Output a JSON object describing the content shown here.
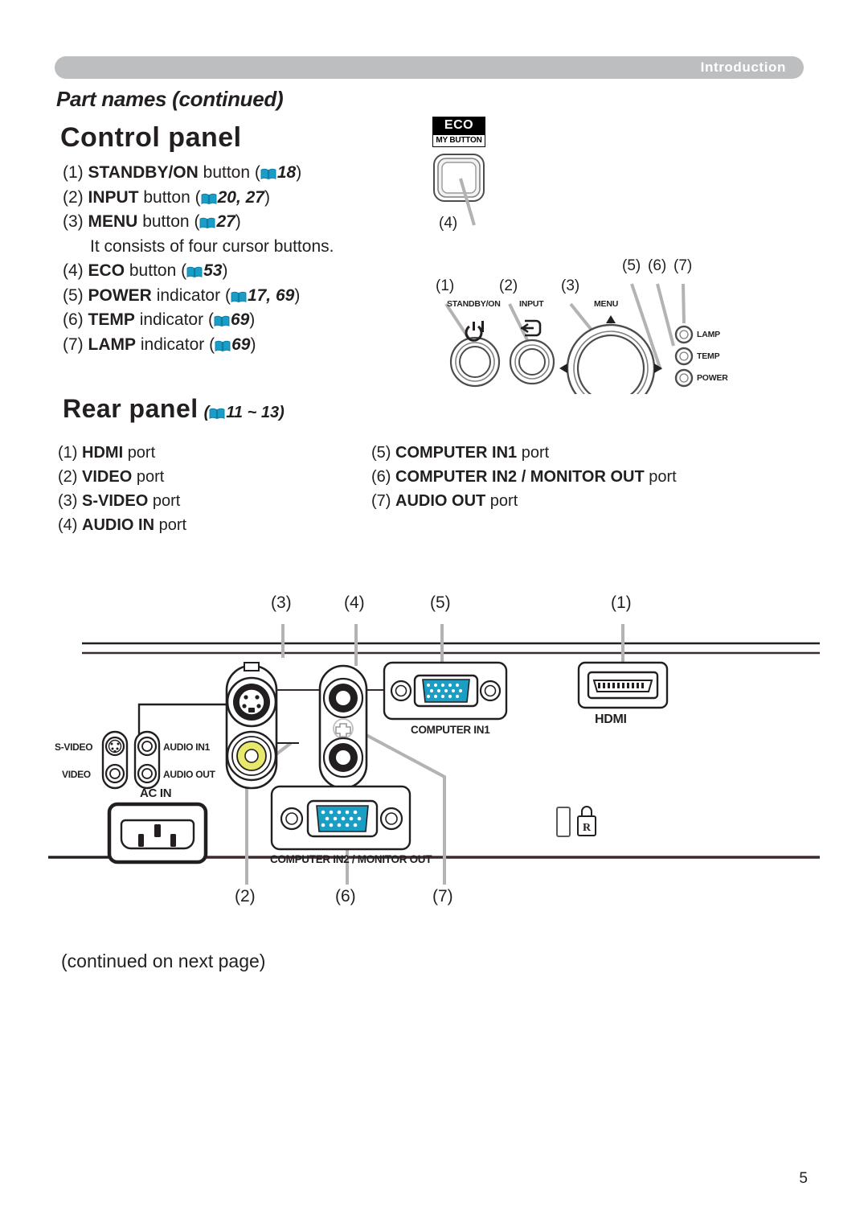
{
  "header": {
    "badge_label": "Introduction",
    "badge_color": "#bcbec0",
    "section_title": "Part names (continued)"
  },
  "control_panel": {
    "heading": "Control panel",
    "items": [
      {
        "num": "(1)",
        "bold": "STANDBY/ON",
        "rest": "button",
        "ref": "18"
      },
      {
        "num": "(2)",
        "bold": "INPUT",
        "rest": "button",
        "ref": "20, 27"
      },
      {
        "num": "(3)",
        "bold": "MENU",
        "rest": "button",
        "ref": "27"
      },
      {
        "num": "(4)",
        "bold": "ECO",
        "rest": "button",
        "ref": "53"
      },
      {
        "num": "(5)",
        "bold": "POWER",
        "rest": "indicator",
        "ref": "17, 69"
      },
      {
        "num": "(6)",
        "bold": "TEMP",
        "rest": "indicator",
        "ref": "69"
      },
      {
        "num": "(7)",
        "bold": "LAMP",
        "rest": "indicator",
        "ref": "69"
      }
    ],
    "sub_note": "It consists of four cursor buttons.",
    "figure": {
      "eco_badge": "ECO",
      "my_button_badge": "MY BUTTON",
      "callout_eco": "(4)",
      "callout_1": "(1)",
      "callout_2": "(2)",
      "callout_3": "(3)",
      "callout_5": "(5)",
      "callout_6": "(6)",
      "callout_7": "(7)",
      "label_standby": "STANDBY/ON",
      "label_input": "INPUT",
      "label_menu": "MENU",
      "label_lamp": "LAMP",
      "label_temp": "TEMP",
      "label_power": "POWER"
    }
  },
  "rear_panel": {
    "heading": "Rear panel",
    "heading_ref": "11 ~ 13",
    "items_left": [
      {
        "num": "(1)",
        "bold": "HDMI",
        "rest": "port"
      },
      {
        "num": "(2)",
        "bold": "VIDEO",
        "rest": "port"
      },
      {
        "num": "(3)",
        "bold": "S-VIDEO",
        "rest": "port"
      },
      {
        "num": "(4)",
        "bold": "AUDIO IN",
        "rest": "port"
      }
    ],
    "items_right": [
      {
        "num": "(5)",
        "bold": "COMPUTER IN1",
        "rest": "port"
      },
      {
        "num": "(6)",
        "bold": "COMPUTER IN2 / MONITOR OUT",
        "rest": "port"
      },
      {
        "num": "(7)",
        "bold": "AUDIO OUT",
        "rest": "port"
      }
    ],
    "figure": {
      "callout_top_3": "(3)",
      "callout_top_4": "(4)",
      "callout_top_5": "(5)",
      "callout_top_1": "(1)",
      "callout_bot_2": "(2)",
      "callout_bot_6": "(6)",
      "callout_bot_7": "(7)",
      "label_svideo": "S-VIDEO",
      "label_video": "VIDEO",
      "label_audio_in1": "AUDIO IN1",
      "label_audio_out": "AUDIO OUT",
      "label_ac_in": "AC IN",
      "label_computer_in1": "COMPUTER IN1",
      "label_computer_in2": "COMPUTER IN2 / MONITOR OUT",
      "label_hdmi": "HDMI"
    }
  },
  "footer": {
    "continued": "(continued on next page)",
    "page_number": "5"
  },
  "colors": {
    "vga_blue": "#1b9ec4",
    "book_icon": "#1a9ec8",
    "video_yellow": "#e8e86a",
    "leader_gray": "#b3b3b3"
  }
}
